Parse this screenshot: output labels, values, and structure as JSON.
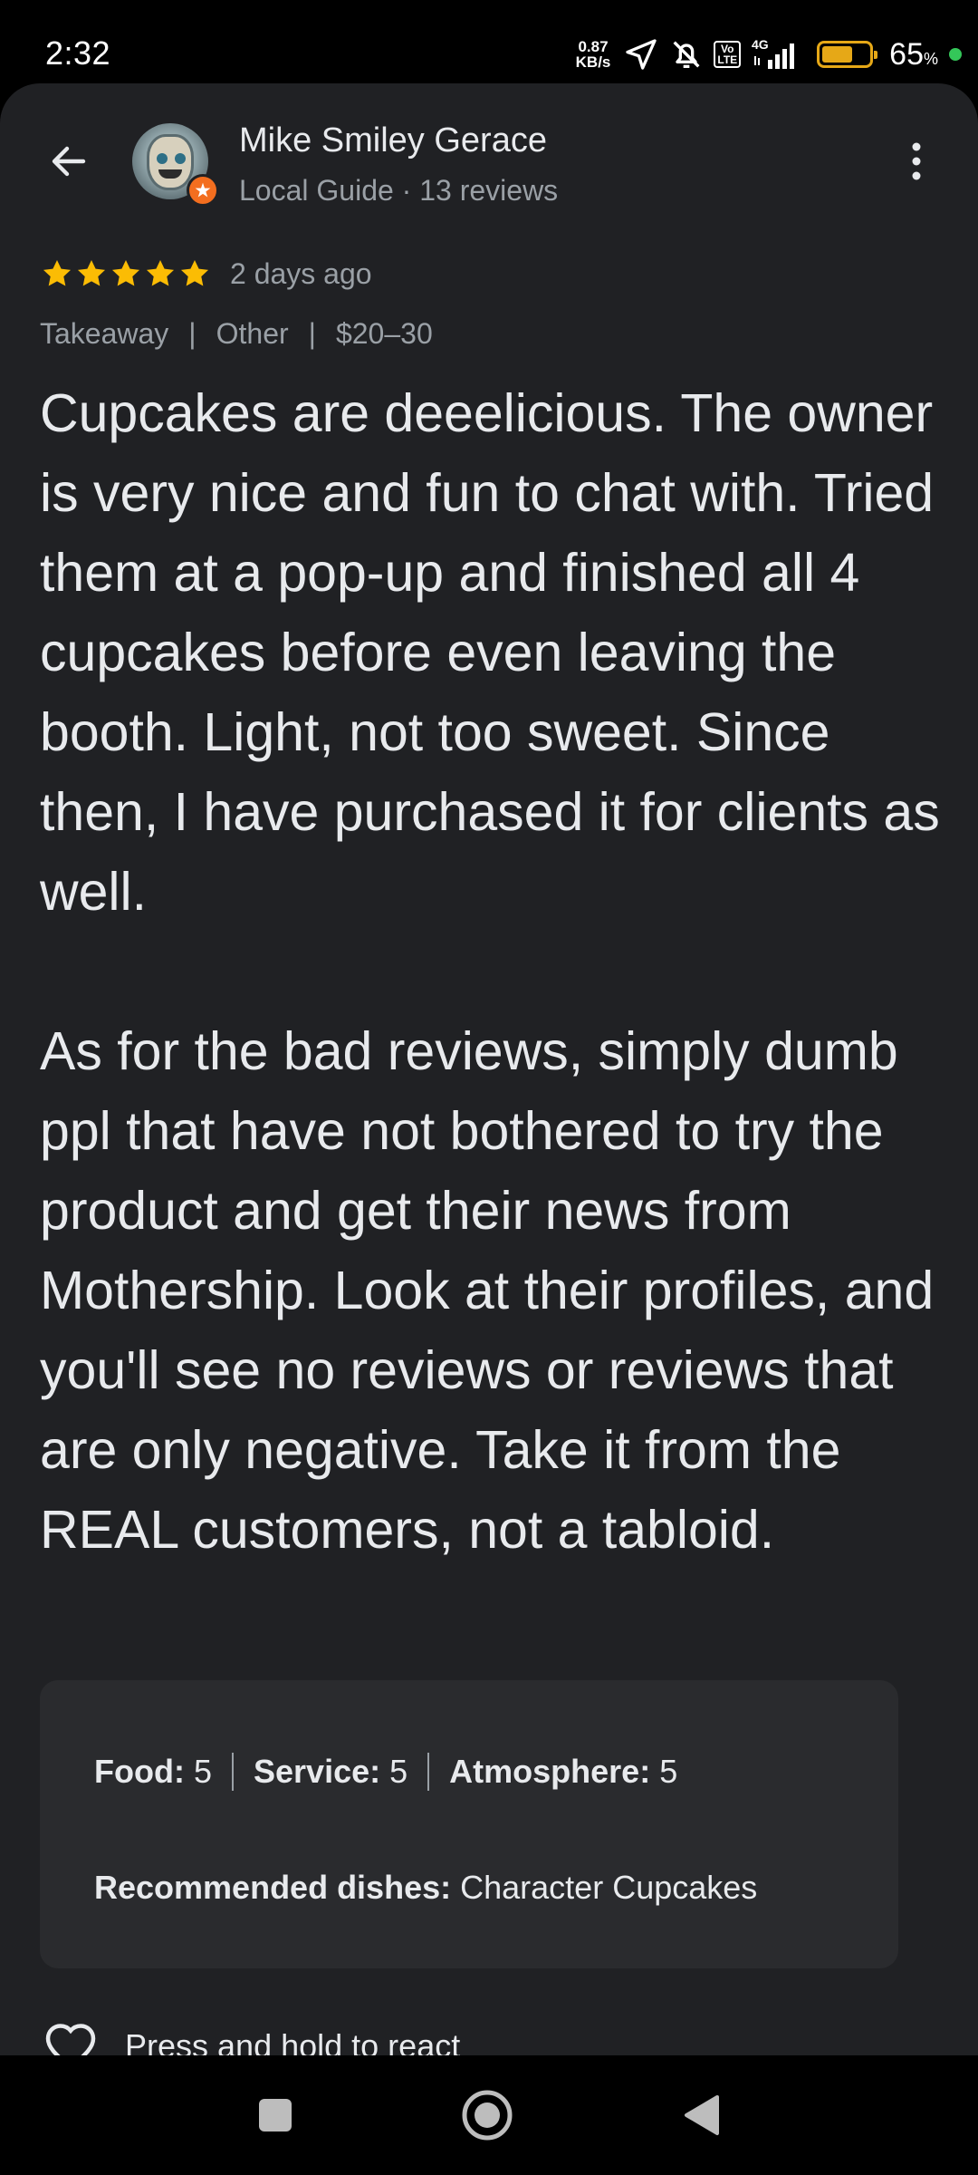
{
  "status_bar": {
    "time": "2:32",
    "net_speed_value": "0.87",
    "net_speed_unit": "KB/s",
    "volte": "Vo\nLTE",
    "network": "4G",
    "battery_percent": "65",
    "battery_unit": "%",
    "battery_level": 0.65,
    "battery_color": "#e6a817",
    "dot_color": "#34c759",
    "icons": [
      "location-arrow-icon",
      "bell-off-icon",
      "volte-icon",
      "signal-icon",
      "battery-icon"
    ]
  },
  "header": {
    "author_name": "Mike Smiley Gerace",
    "author_meta": "Local Guide · 13 reviews",
    "back_icon": "arrow-back-icon",
    "more_icon": "more-vert-icon",
    "badge_icon": "local-guide-star-icon"
  },
  "review": {
    "stars": 5,
    "star_color": "#fbbc04",
    "date": "2 days ago",
    "tags": [
      "Takeaway",
      "Other",
      "$20–30"
    ],
    "text": "Cupcakes are deeelicious. The owner is very nice and fun to chat with. Tried them at a pop-up and finished all 4 cupcakes before even leaving the booth. Light, not too sweet. Since then, I have purchased it for clients as well.\n\nAs for the bad reviews, simply dumb ppl that have not bothered to try the product and get their news from Mothership. Look at their profiles, and you'll see no reviews or reviews that are only negative. Take it from the REAL customers, not a tabloid."
  },
  "ratings": {
    "food_label": "Food:",
    "food_value": "5",
    "service_label": "Service:",
    "service_value": "5",
    "atmosphere_label": "Atmosphere:",
    "atmosphere_value": "5",
    "dishes_label": "Recommended dishes:",
    "dishes_value": "Character Cupcakes"
  },
  "react": {
    "label": "Press and hold to react",
    "icon": "heart-outline-icon"
  },
  "nav": {
    "icons": [
      "recents-square-icon",
      "home-circle-icon",
      "back-triangle-icon"
    ]
  }
}
